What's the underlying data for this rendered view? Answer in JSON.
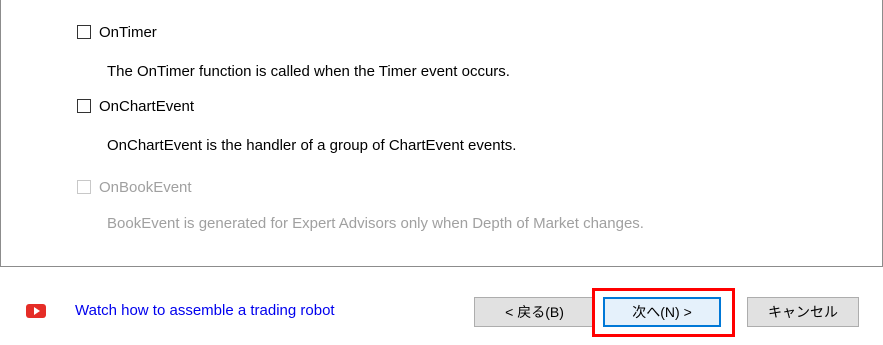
{
  "options": [
    {
      "label": "OnTimer",
      "description": "The OnTimer function is called when the Timer event occurs.",
      "checked": false,
      "enabled": true
    },
    {
      "label": "OnChartEvent",
      "description": "OnChartEvent is the handler of a group of ChartEvent events.",
      "checked": false,
      "enabled": true
    },
    {
      "label": "OnBookEvent",
      "description": "BookEvent is generated for Expert Advisors only when Depth of Market changes.",
      "checked": false,
      "enabled": false
    }
  ],
  "footer": {
    "link_icon": "youtube-play-icon",
    "link_text": "Watch how to assemble a trading robot",
    "back_label": "< 戻る(B)",
    "next_label": "次へ(N) >",
    "cancel_label": "キャンセル"
  },
  "colors": {
    "link": "#0000ee",
    "highlight": "#ff0000",
    "youtube": "#e52d27",
    "focus": "#0078d7"
  }
}
